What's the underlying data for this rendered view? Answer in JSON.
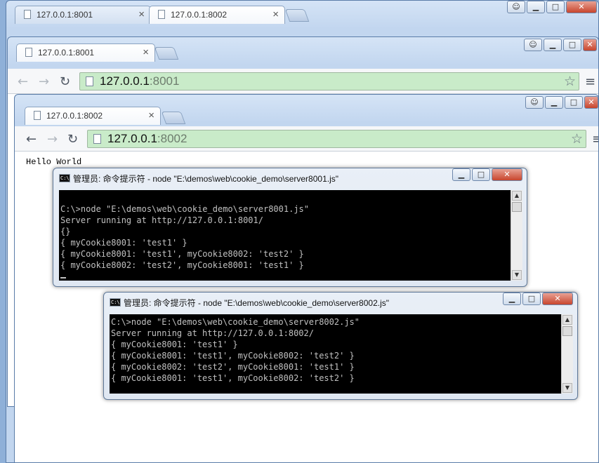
{
  "back_window": {
    "tabs": [
      {
        "label": "127.0.0.1:8001"
      },
      {
        "label": "127.0.0.1:8002"
      }
    ]
  },
  "mid_window": {
    "tab": {
      "label": "127.0.0.1:8001"
    },
    "address": {
      "host": "127.0.0.1",
      "port": ":8001"
    }
  },
  "front_window": {
    "tab": {
      "label": "127.0.0.1:8002"
    },
    "address": {
      "host": "127.0.0.1",
      "port": ":8002"
    },
    "page_text": "Hello World"
  },
  "cmd1": {
    "title": "管理员: 命令提示符 - node  \"E:\\demos\\web\\cookie_demo\\server8001.js\"",
    "lines": [
      "",
      "C:\\>node \"E:\\demos\\web\\cookie_demo\\server8001.js\"",
      "Server running at http://127.0.0.1:8001/",
      "{}",
      "{ myCookie8001: 'test1' }",
      "{ myCookie8001: 'test1', myCookie8002: 'test2' }",
      "{ myCookie8002: 'test2', myCookie8001: 'test1' }"
    ]
  },
  "cmd2": {
    "title": "管理员: 命令提示符 - node  \"E:\\demos\\web\\cookie_demo\\server8002.js\"",
    "lines": [
      "C:\\>node \"E:\\demos\\web\\cookie_demo\\server8002.js\"",
      "Server running at http://127.0.0.1:8002/",
      "{ myCookie8001: 'test1' }",
      "{ myCookie8001: 'test1', myCookie8002: 'test2' }",
      "{ myCookie8002: 'test2', myCookie8001: 'test1' }",
      "{ myCookie8001: 'test1', myCookie8002: 'test2' }"
    ]
  },
  "icons": {
    "close": "×",
    "minimize": "▁",
    "maximize": "□",
    "close_win": "✕",
    "back": "←",
    "forward": "→",
    "reload": "↻",
    "star": "☆",
    "menu": "≡",
    "user": "👤",
    "scroll_up": "▲",
    "scroll_down": "▼"
  }
}
